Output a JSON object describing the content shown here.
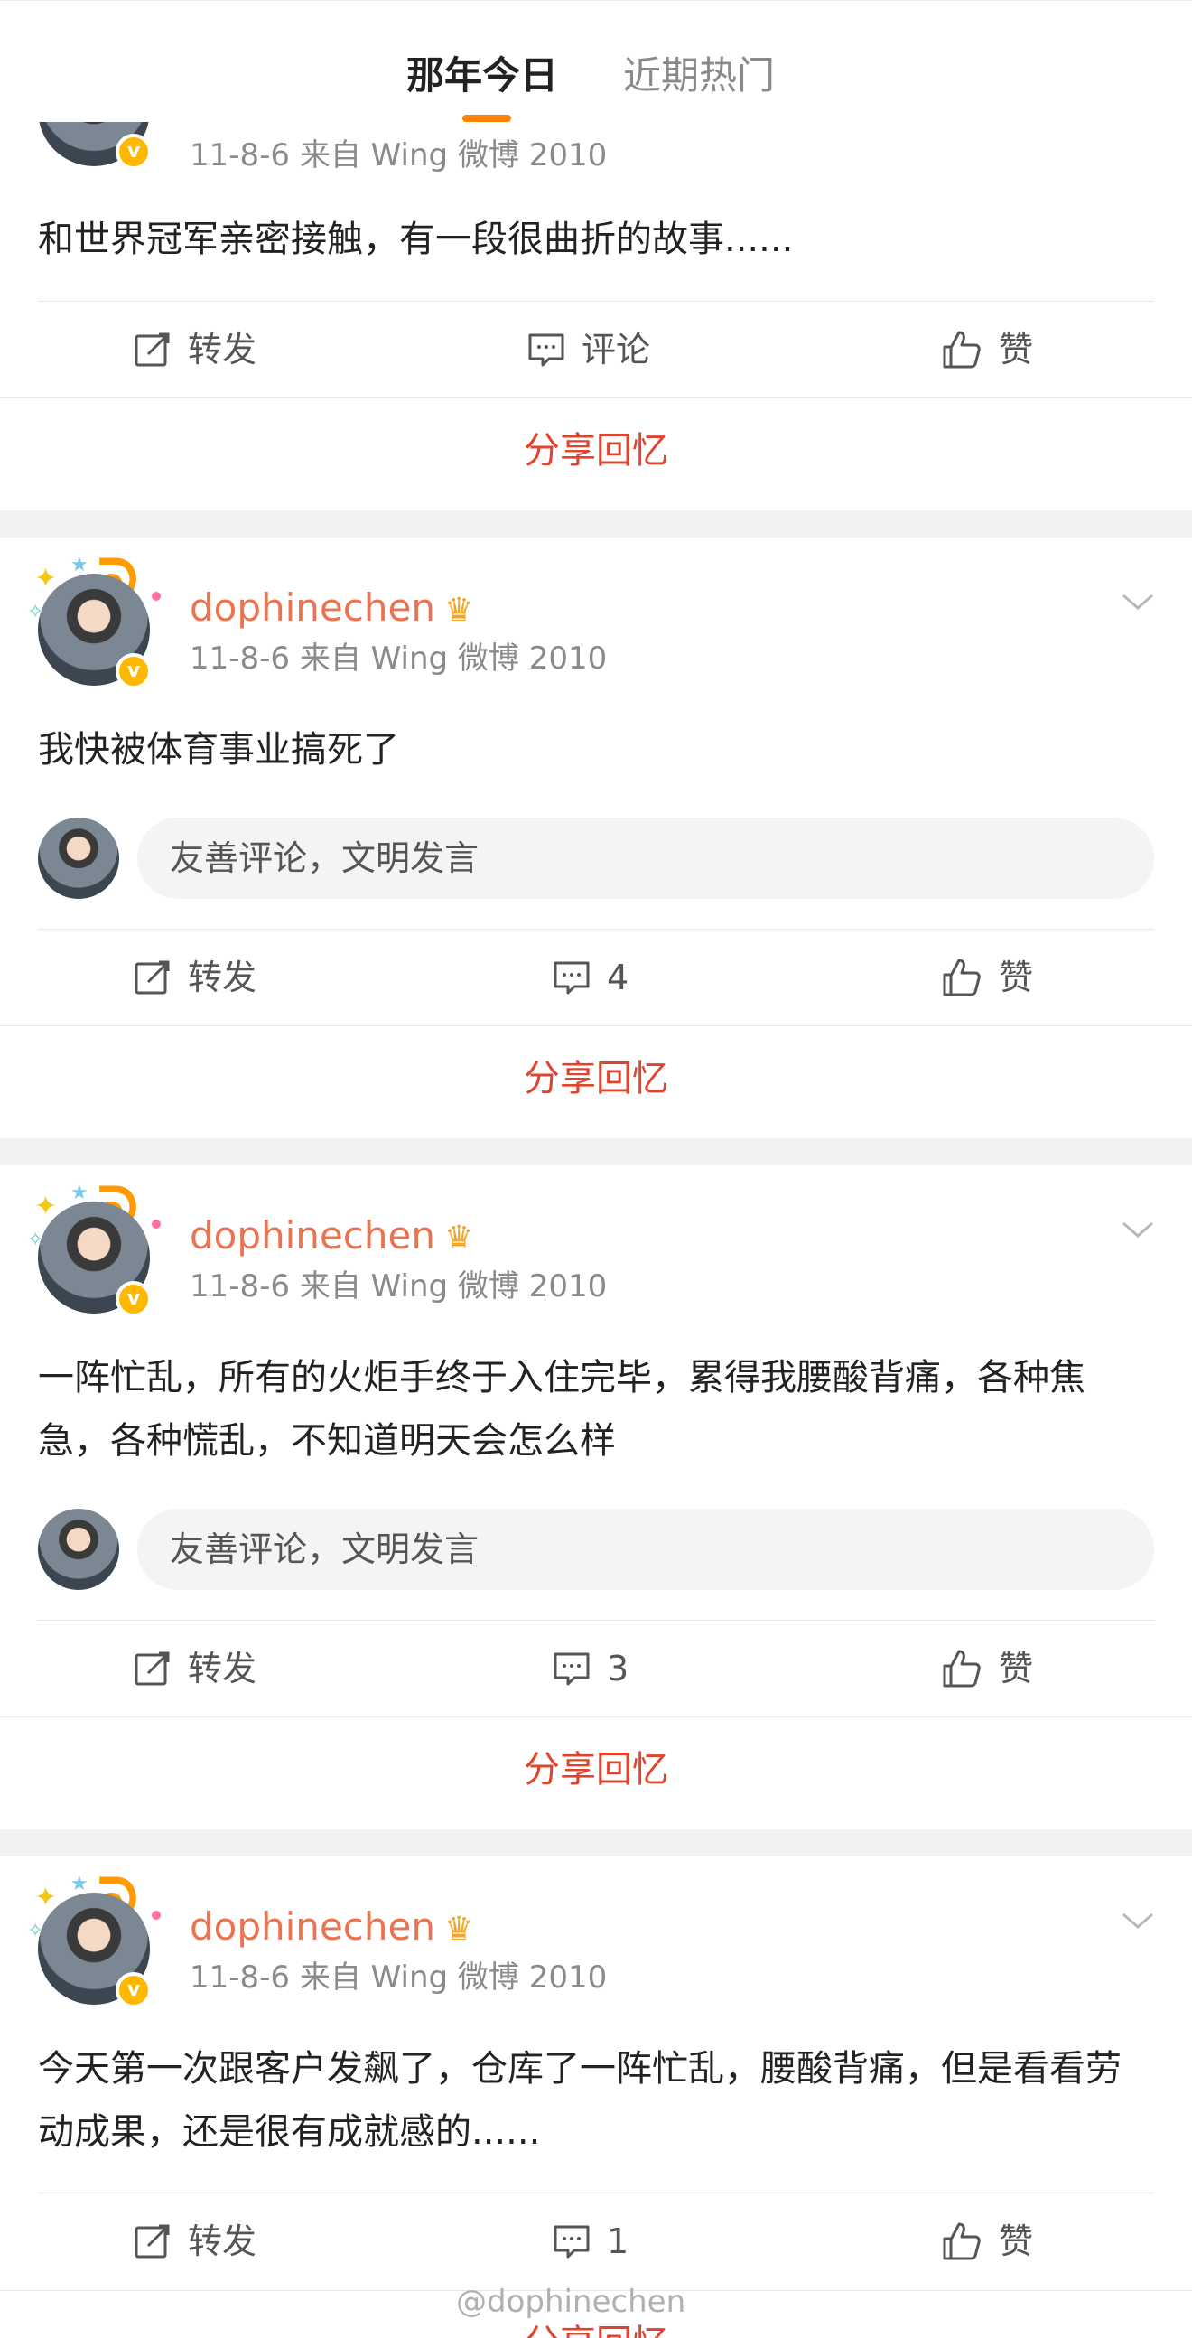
{
  "tabs": [
    {
      "label": "那年今日",
      "active": true
    },
    {
      "label": "近期热门",
      "active": false
    }
  ],
  "posts": [
    {
      "username": "",
      "meta": "11-8-6  来自 Wing 微博 2010",
      "text": "和世界冠军亲密接触，有一段很曲折的故事......",
      "has_comment_box": false,
      "repost_label": "转发",
      "comment_label": "评论",
      "like_label": "赞",
      "share_label": "分享回忆"
    },
    {
      "username": "dophinechen",
      "meta": "11-8-6  来自 Wing 微博 2010",
      "text": "我快被体育事业搞死了",
      "has_comment_box": true,
      "comment_placeholder": "友善评论，文明发言",
      "repost_label": "转发",
      "comment_label": "4",
      "like_label": "赞",
      "share_label": "分享回忆"
    },
    {
      "username": "dophinechen",
      "meta": "11-8-6  来自 Wing 微博 2010",
      "text": "一阵忙乱，所有的火炬手终于入住完毕，累得我腰酸背痛，各种焦急，各种慌乱，不知道明天会怎么样",
      "has_comment_box": true,
      "comment_placeholder": "友善评论，文明发言",
      "repost_label": "转发",
      "comment_label": "3",
      "like_label": "赞",
      "share_label": "分享回忆"
    },
    {
      "username": "dophinechen",
      "meta": "11-8-6  来自 Wing 微博 2010",
      "text": "今天第一次跟客户发飙了，仓库了一阵忙乱，腰酸背痛，但是看看劳动成果，还是很有成就感的......",
      "has_comment_box": false,
      "repost_label": "转发",
      "comment_label": "1",
      "like_label": "赞",
      "share_label": "分享回忆"
    }
  ],
  "watermark": "@dophinechen",
  "colors": {
    "accent": "#ff8200",
    "username": "#eb7350",
    "share": "#e0442e",
    "verified": "#ffb800"
  }
}
